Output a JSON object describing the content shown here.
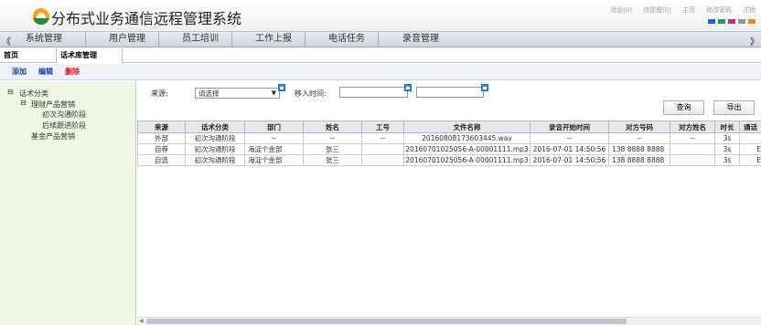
{
  "header": {
    "title": "分布式业务通信远程管理系统",
    "links": [
      "消息(0)",
      "待提醒(0)",
      "主页",
      "修改密码",
      "注销"
    ],
    "swatch_colors": [
      "#1f64c8",
      "#1fa05a",
      "#c02e8c",
      "#8d98a8",
      "#e88a1e"
    ]
  },
  "nav": {
    "left_arrow": "《",
    "right_arrow": "》",
    "items": [
      "系统管理",
      "用户管理",
      "员工培训",
      "工作上报",
      "电话任务",
      "录音管理"
    ]
  },
  "tabs": {
    "home": "首页",
    "current": "话术库管理"
  },
  "toolbar": {
    "add": "添加",
    "edit": "编辑",
    "delete": "删除",
    "add_color": "#1a3fa8",
    "edit_color": "#1a3fa8",
    "delete_color": "#d01818"
  },
  "tree": {
    "root": "话术分类",
    "group1": "理财产品营销",
    "leaf1": "初次沟通阶段",
    "leaf2": "后续跟进阶段",
    "group2": "基金产品营销"
  },
  "filter": {
    "source_label": "来源:",
    "source_value": "请选择",
    "time_label": "移入时间:",
    "range_sep": "--",
    "query": "查询",
    "export": "导出"
  },
  "table": {
    "headers": [
      "来源",
      "话术分类",
      "部门",
      "姓名",
      "工号",
      "文件名称",
      "录音开始时间",
      "对方号码",
      "对方姓名",
      "时长",
      "通话"
    ],
    "rows": [
      [
        "外部",
        "初次沟通阶段",
        "--",
        "--",
        "--",
        "20160808173603445.wav",
        "--",
        "--",
        "--",
        "3s",
        ""
      ],
      [
        "自荐",
        "初次沟通阶段",
        "海淀个金部",
        "张三",
        "",
        "20160701025056-A-00001111.mp3",
        "2016-07-01 14:50:56",
        "138 8888 8888",
        "",
        "3s",
        "E"
      ],
      [
        "自选",
        "初次沟通阶段",
        "海淀个金部",
        "张三",
        "",
        "20160701025056-A-00001111.mp3",
        "2016-07-01 14:50:56",
        "138 8888 8888",
        "",
        "3s",
        "E"
      ]
    ]
  }
}
